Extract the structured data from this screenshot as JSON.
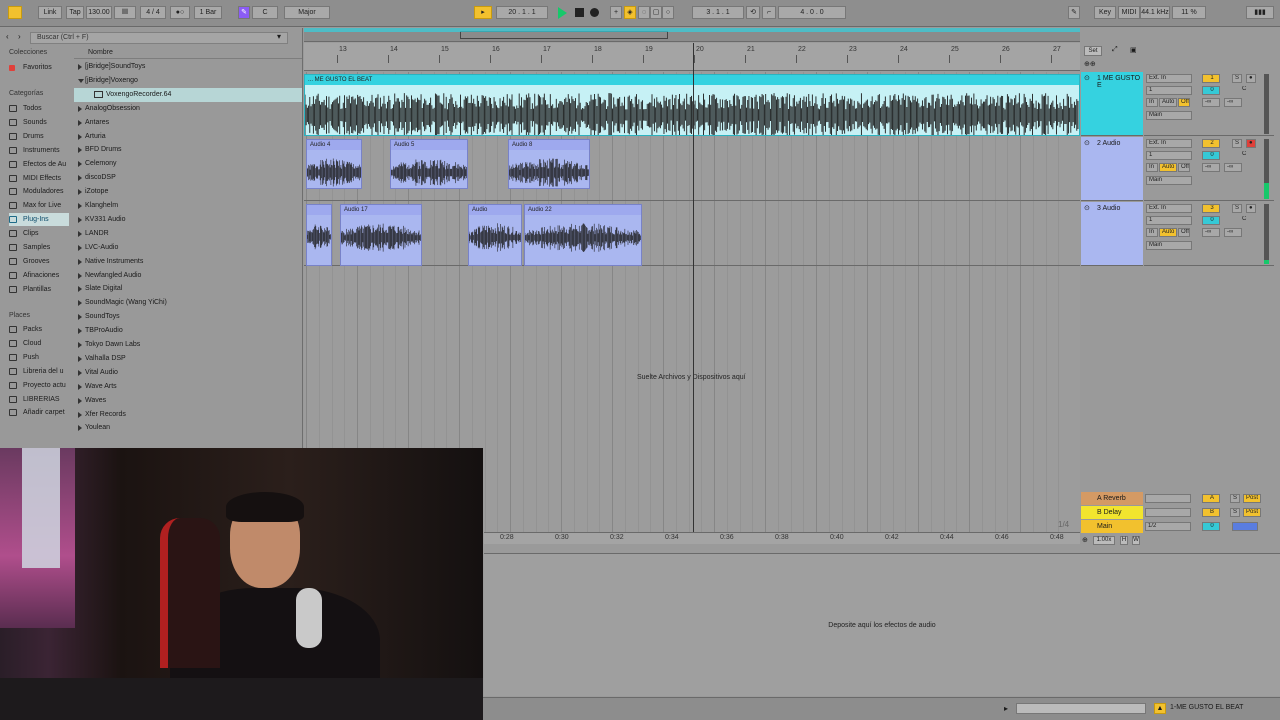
{
  "transport": {
    "link": "Link",
    "tap": "Tap",
    "tempo": "130.00",
    "signature": "4 / 4",
    "quantize": "1 Bar",
    "key": "C",
    "scale": "Major",
    "position": "20 .   1 .   1",
    "loop_start": "3 .   1 .   1",
    "loop_length": "4 .   0 .   0",
    "key_label": "Key",
    "midi_label": "MIDI",
    "sample_rate": "44.1 kHz",
    "cpu": "11 %"
  },
  "browser": {
    "search_placeholder": "Buscar (Ctrl + F)",
    "collections_header": "Colecciones",
    "favorites": "Favoritos",
    "categories_header": "Categorías",
    "categories": [
      "Todos",
      "Sounds",
      "Drums",
      "Instruments",
      "Efectos de Au",
      "MIDI Effects",
      "Moduladores",
      "Max for Live",
      "Plug-Ins",
      "Clips",
      "Samples",
      "Grooves",
      "Afinaciones",
      "Plantillas"
    ],
    "places_header": "Places",
    "places": [
      "Packs",
      "Cloud",
      "Push",
      "Libreria del u",
      "Proyecto actu",
      "LIBRERIAS",
      "Añadir carpet"
    ],
    "name_header": "Nombre",
    "items": [
      "[jBridge]SoundToys",
      "[jBridge]Voxengo",
      "VoxengoRecorder.64",
      "AnalogObsession",
      "Antares",
      "Arturia",
      "BFD Drums",
      "Celemony",
      "discoDSP",
      "iZotope",
      "Klanghelm",
      "KV331 Audio",
      "LANDR",
      "LVC-Audio",
      "Native Instruments",
      "Newfangled Audio",
      "Slate Digital",
      "SoundMagic (Wang YiChi)",
      "SoundToys",
      "TBProAudio",
      "Tokyo Dawn Labs",
      "Valhalla DSP",
      "Vital Audio",
      "Wave Arts",
      "Waves",
      "Xfer Records",
      "Youlean"
    ]
  },
  "ruler": {
    "bars": [
      "13",
      "14",
      "15",
      "16",
      "17",
      "18",
      "19",
      "20",
      "21",
      "22",
      "23",
      "24",
      "25",
      "26",
      "27"
    ],
    "times": [
      "0:28",
      "0:30",
      "0:32",
      "0:34",
      "0:36",
      "0:38",
      "0:40",
      "0:42",
      "0:44",
      "0:46",
      "0:48"
    ],
    "set_label": "Set"
  },
  "tracks": [
    {
      "name": "1 ME GUSTO E",
      "clip_title": "... ME GUSTO EL BEAT",
      "input": "Ext. In",
      "channel": "1",
      "output": "Main",
      "number": "1",
      "color": "#35d2e0"
    },
    {
      "name": "2 Audio",
      "clips": [
        "Audio 4",
        "Audio 5",
        "Audio 8"
      ],
      "input": "Ext. In",
      "channel": "1",
      "output": "Main",
      "number": "2",
      "color": "#aab7f0"
    },
    {
      "name": "3 Audio",
      "clips": [
        "Audio 17",
        "Audio",
        "Audio 22"
      ],
      "input": "Ext. In",
      "channel": "1",
      "output": "Main",
      "number": "3",
      "color": "#aab7f0"
    }
  ],
  "io": {
    "in": "In",
    "auto": "Auto",
    "off": "Off",
    "minus_inf": "-∞",
    "zero": "0",
    "center": "C",
    "solo": "S"
  },
  "returns": [
    {
      "name": "A Reverb",
      "letter": "A"
    },
    {
      "name": "B Delay",
      "letter": "B"
    },
    {
      "name": "Main",
      "letter": "0"
    }
  ],
  "return_extra": {
    "post": "Post",
    "half": "1/2",
    "quarter": "1/4",
    "zoom": "1.00x"
  },
  "drop_files": "Suelte Archivos y Dispositivos aquí",
  "drop_effects": "Deposite aquí los efectos de audio",
  "status": {
    "selected_track": "1-ME GUSTO EL BEAT"
  },
  "colors": {
    "accent_yellow": "#f2c12e",
    "cyan": "#35d2e0",
    "clip_blue": "#aab7f0",
    "play_green": "#16c86a"
  }
}
